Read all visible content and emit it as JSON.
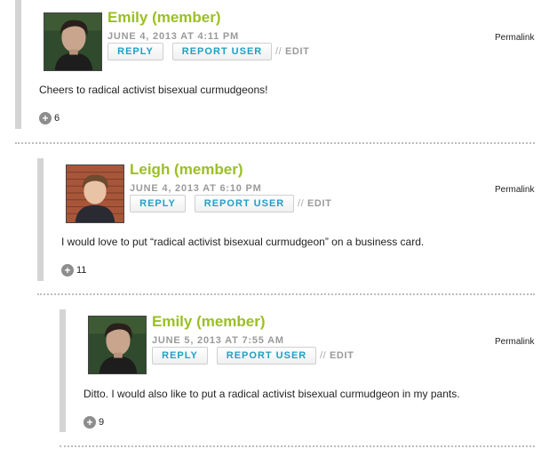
{
  "comments": [
    {
      "author": "Emily (member)",
      "date": "JUNE 4, 2013 AT 4:11 PM",
      "reply_label": "REPLY",
      "report_label": "REPORT USER",
      "edit_sep": "//",
      "edit_label": "EDIT",
      "permalink": "Permalink",
      "text": "Cheers to radical activist bisexual curmudgeons!",
      "votes": "6",
      "avatar": "emily-photo"
    },
    {
      "author": "Leigh (member)",
      "date": "JUNE 4, 2013 AT 6:10 PM",
      "reply_label": "REPLY",
      "report_label": "REPORT USER",
      "edit_sep": "//",
      "edit_label": "EDIT",
      "permalink": "Permalink",
      "text": "I would love to put “radical activist bisexual curmudgeon” on a business card.",
      "votes": "11",
      "avatar": "leigh-photo"
    },
    {
      "author": "Emily (member)",
      "date": "JUNE 5, 2013 AT 7:55 AM",
      "reply_label": "REPLY",
      "report_label": "REPORT USER",
      "edit_sep": "//",
      "edit_label": "EDIT",
      "permalink": "Permalink",
      "text": "Ditto. I would also like to put a radical activist bisexual curmudgeon in my pants.",
      "votes": "9",
      "avatar": "emily-photo"
    }
  ],
  "colors": {
    "author": "#9bbf24",
    "button_text": "#1fa0c4",
    "meta": "#9a9a9a",
    "thread_bar": "#d4d4d4"
  }
}
